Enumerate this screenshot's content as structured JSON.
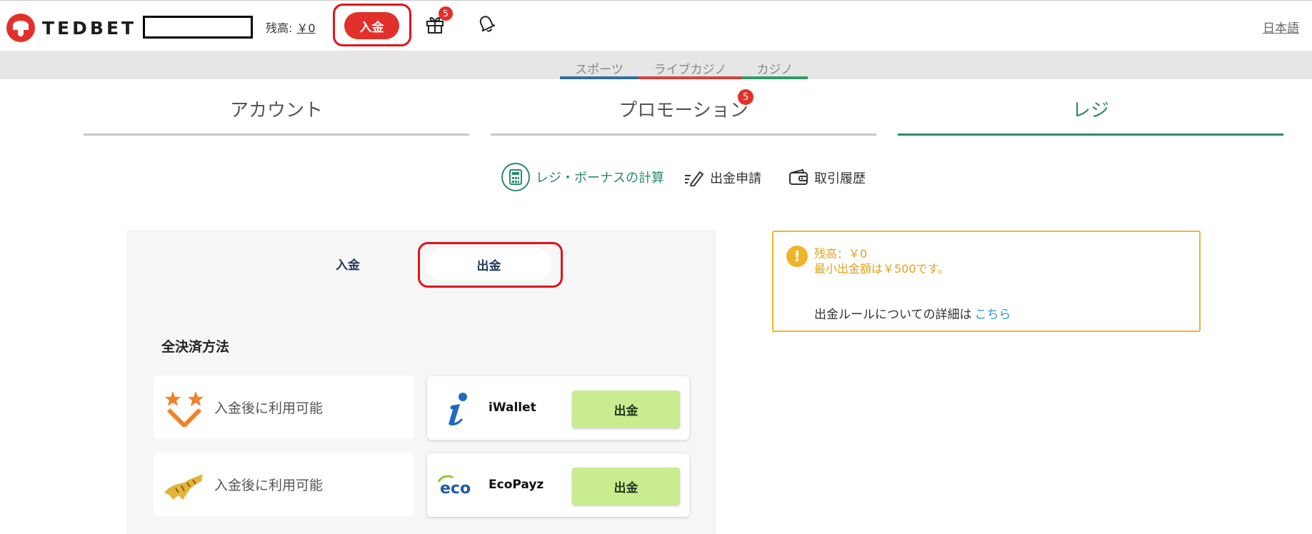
{
  "header": {
    "brand": "TEDBET",
    "balance_label": "残高:",
    "balance_value": "￥0",
    "deposit_button": "入金",
    "gift_badge": "5",
    "language": "日本語"
  },
  "subnav": [
    {
      "label": "スポーツ",
      "color": "#2f6fa0"
    },
    {
      "label": "ライブカジノ",
      "color": "#d9413a"
    },
    {
      "label": "カジノ",
      "color": "#2f9a6a"
    }
  ],
  "tabs": [
    {
      "label": "アカウント",
      "active": false
    },
    {
      "label": "プロモーション",
      "active": false,
      "badge": "5"
    },
    {
      "label": "レジ",
      "active": true
    }
  ],
  "actions": [
    {
      "label": "レジ・ボーナスの計算",
      "icon": "calculator-icon"
    },
    {
      "label": "出金申請",
      "icon": "pencil-icon"
    },
    {
      "label": "取引履歴",
      "icon": "wallet-icon"
    }
  ],
  "cashier": {
    "toggle_deposit": "入金",
    "toggle_withdraw": "出金",
    "section_title": "全決済方法",
    "unavailable": [
      {
        "text": "入金後に利用可能",
        "icon": "stars-icon"
      },
      {
        "text": "入金後に利用可能",
        "icon": "tiger-icon"
      }
    ],
    "methods": [
      {
        "name": "iWallet",
        "button": "出金",
        "icon": "iwallet-icon"
      },
      {
        "name": "EcoPayz",
        "button": "出金",
        "icon": "ecopayz-icon"
      }
    ]
  },
  "info": {
    "balance_line": "残高：￥0",
    "minimum_line": "最小出金額は￥500です。",
    "rules_text": "出金ルールについての詳細は",
    "rules_link": "こちら"
  },
  "colors": {
    "brand": "#e2312a",
    "accent_green": "#2a8a6a",
    "warning": "#f0b429",
    "withdraw_button": "#c9ec8f"
  }
}
